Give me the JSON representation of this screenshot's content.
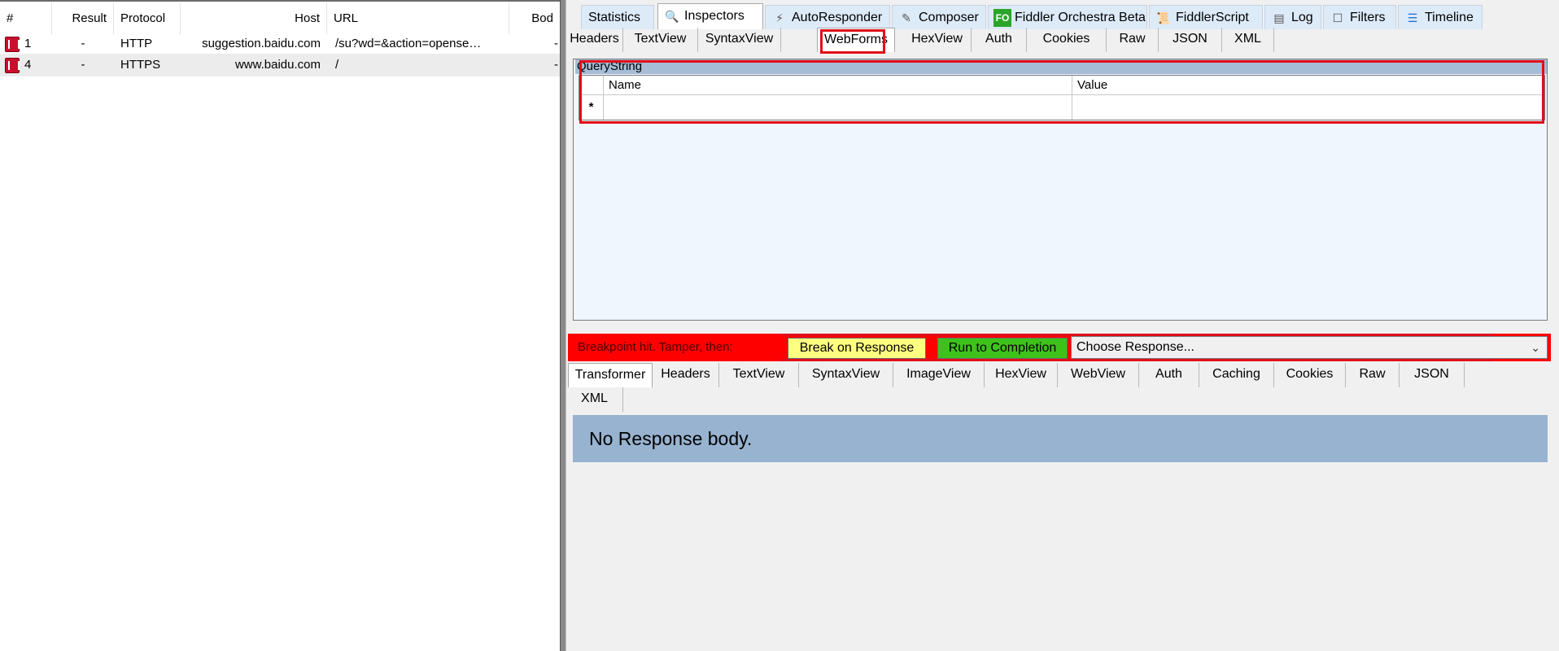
{
  "sessions": {
    "columns": [
      "#",
      "Result",
      "Protocol",
      "Host",
      "URL",
      "Bod"
    ],
    "rows": [
      {
        "id": "1",
        "result": "-",
        "protocol": "HTTP",
        "host": "suggestion.baidu.com",
        "url": "/su?wd=&action=opense…",
        "body": "-"
      },
      {
        "id": "4",
        "result": "-",
        "protocol": "HTTPS",
        "host": "www.baidu.com",
        "url": "/",
        "body": "-"
      }
    ]
  },
  "top_tabs": [
    {
      "label": "Statistics",
      "icon": "statistics-icon"
    },
    {
      "label": "Inspectors",
      "icon": "inspectors-icon"
    },
    {
      "label": "AutoResponder",
      "icon": "lightning-icon"
    },
    {
      "label": "Composer",
      "icon": "composer-icon"
    },
    {
      "label": "Fiddler Orchestra Beta",
      "icon": "fo-icon",
      "icon_text": "FO"
    },
    {
      "label": "FiddlerScript",
      "icon": "script-icon"
    },
    {
      "label": "Log",
      "icon": "log-icon"
    },
    {
      "label": "Filters",
      "icon": "checkbox-icon"
    },
    {
      "label": "Timeline",
      "icon": "timeline-icon"
    }
  ],
  "request_tabs": [
    "Headers",
    "TextView",
    "SyntaxView",
    "WebForms",
    "HexView",
    "Auth",
    "Cookies",
    "Raw",
    "JSON",
    "XML"
  ],
  "querystring": {
    "label": "QueryString",
    "columns": [
      "Name",
      "Value"
    ],
    "new_row_marker": "*"
  },
  "breakpoint": {
    "message": "Breakpoint hit. Tamper, then:",
    "break_on_response": "Break on Response",
    "run_to_completion": "Run to Completion",
    "choose_response": "Choose Response...",
    "colors": {
      "bar": "#ff0000",
      "break_button": "#ffff80",
      "run_button": "#3ec21a"
    }
  },
  "response_tabs": [
    "Transformer",
    "Headers",
    "TextView",
    "SyntaxView",
    "ImageView",
    "HexView",
    "WebView",
    "Auth",
    "Caching",
    "Cookies",
    "Raw",
    "JSON",
    "XML"
  ],
  "response_body": "No Response body.",
  "colors": {
    "highlight": "#e10e19",
    "tab_bg": "#ddeaf8"
  }
}
